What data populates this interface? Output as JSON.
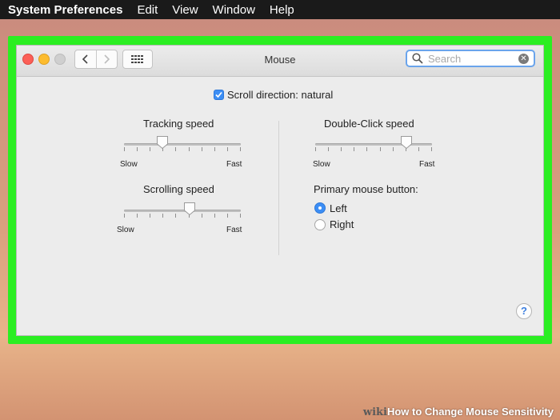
{
  "menubar": {
    "app": "System Preferences",
    "items": [
      "Edit",
      "View",
      "Window",
      "Help"
    ]
  },
  "window": {
    "title": "Mouse",
    "search_placeholder": "Search"
  },
  "scroll_direction": {
    "label": "Scroll direction: natural",
    "checked": true
  },
  "tracking": {
    "label": "Tracking speed",
    "min": "Slow",
    "max": "Fast",
    "value_fraction": 0.33
  },
  "scrolling": {
    "label": "Scrolling speed",
    "min": "Slow",
    "max": "Fast",
    "value_fraction": 0.56
  },
  "double_click": {
    "label": "Double-Click speed",
    "min": "Slow",
    "max": "Fast",
    "value_fraction": 0.78
  },
  "primary_button": {
    "label": "Primary mouse button:",
    "options": [
      "Left",
      "Right"
    ],
    "selected": "Left"
  },
  "help": "?",
  "watermark": {
    "brand": "wiki",
    "text": "How to Change Mouse Sensitivity"
  },
  "colors": {
    "highlight_frame": "#2bee22",
    "accent": "#3c8ef5"
  }
}
